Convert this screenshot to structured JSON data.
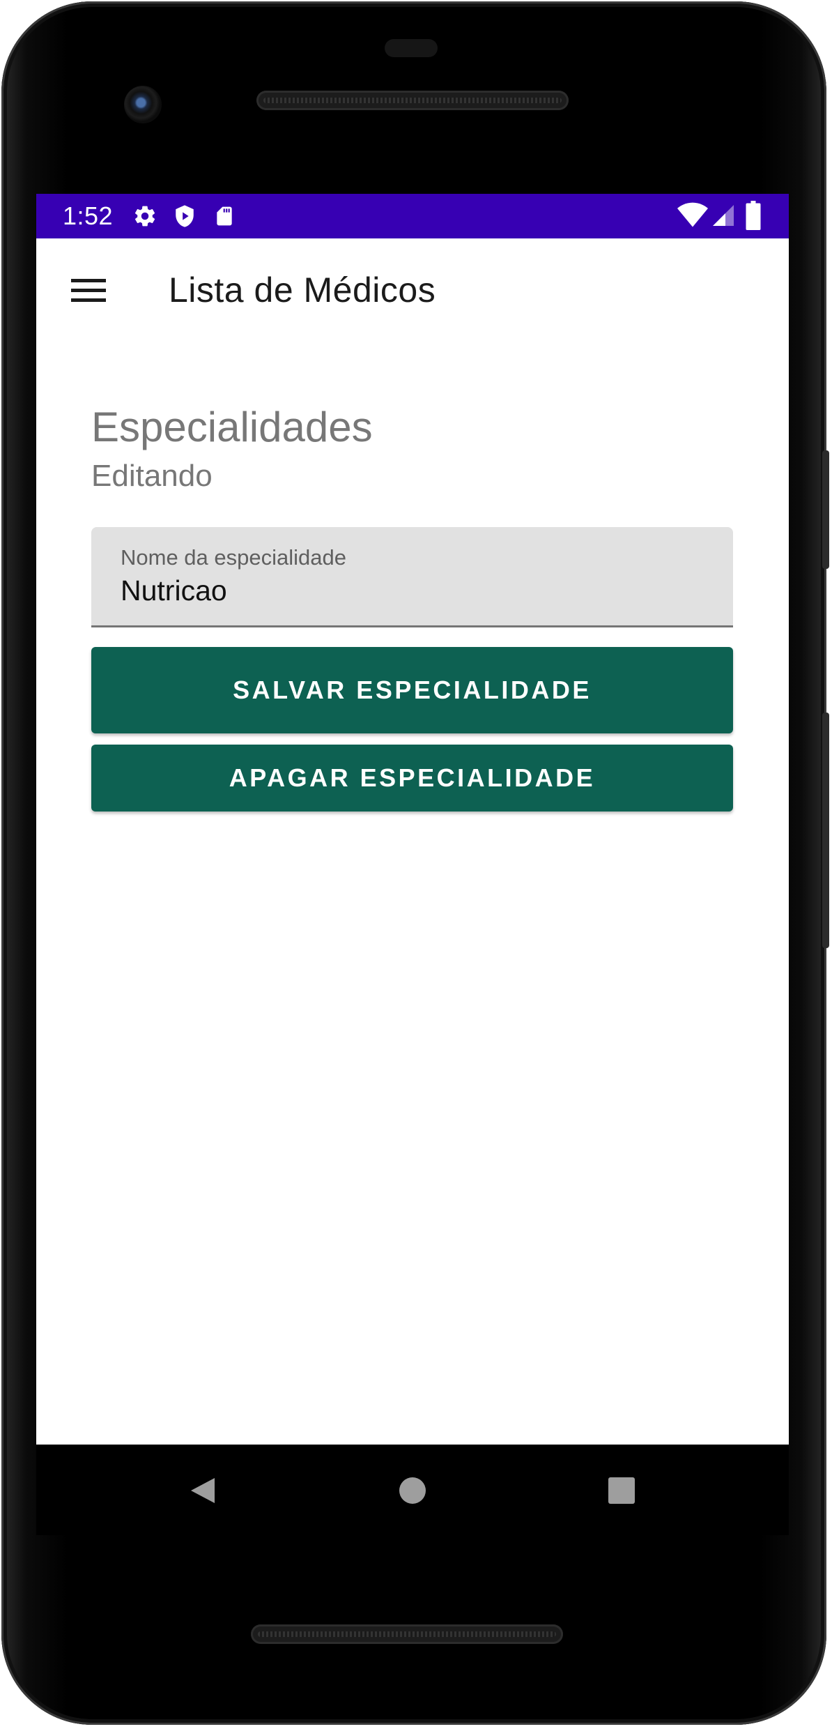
{
  "status_bar": {
    "time": "1:52",
    "icons": [
      "gear-icon",
      "shield-icon",
      "sd-card-icon",
      "wifi-icon",
      "signal-icon",
      "battery-icon"
    ],
    "color": "#3700b3"
  },
  "app_bar": {
    "title": "Lista de Médicos",
    "menu_icon": "hamburger-menu-icon"
  },
  "section": {
    "title": "Especialidades",
    "subtitle": "Editando"
  },
  "form": {
    "name_field": {
      "label": "Nome da especialidade",
      "value": "Nutricao"
    },
    "save_button_label": "SALVAR ESPECIALIDADE",
    "delete_button_label": "APAGAR ESPECIALIDADE",
    "button_color": "#0d6152"
  },
  "nav_bar": {
    "back_icon": "back-triangle-icon",
    "home_icon": "home-circle-icon",
    "recents_icon": "recents-square-icon"
  }
}
